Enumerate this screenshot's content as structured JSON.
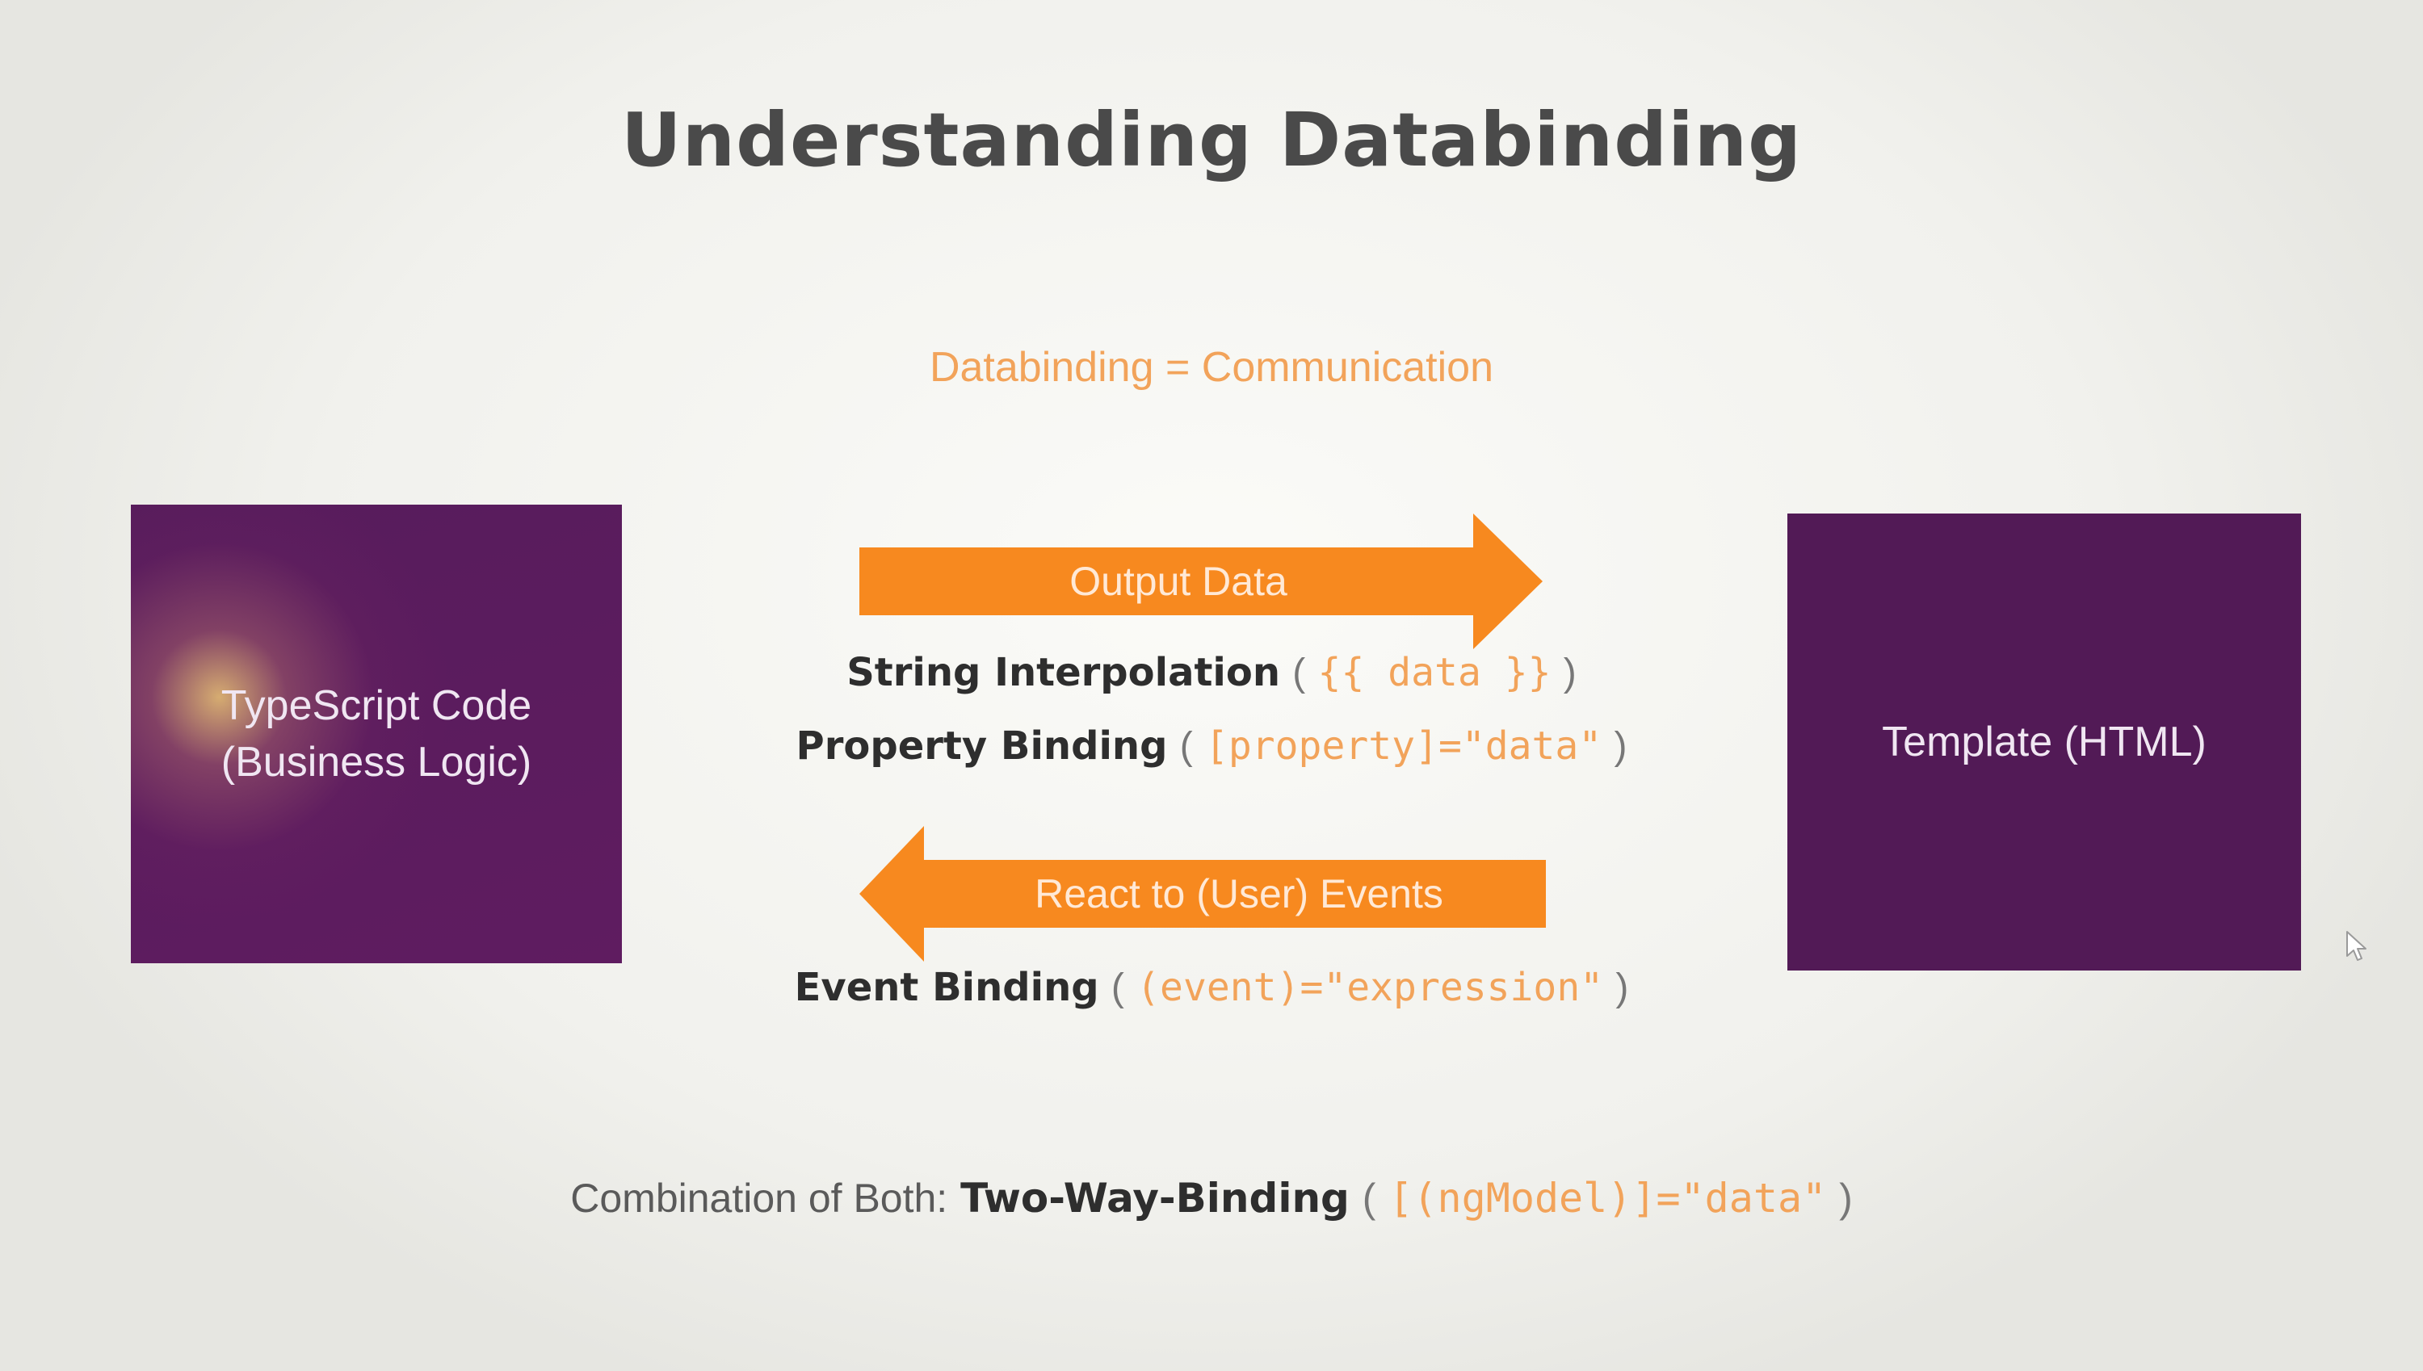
{
  "slide": {
    "title": "Understanding Databinding",
    "subtitle": "Databinding = Communication"
  },
  "left_box": {
    "line1": "TypeScript Code",
    "line2": "(Business Logic)"
  },
  "right_box": {
    "label": "Template (HTML)"
  },
  "output_arrow": {
    "label": "Output Data",
    "direction": "right",
    "color": "#f7891f"
  },
  "input_arrow": {
    "label": "React to (User) Events",
    "direction": "left",
    "color": "#f7891f"
  },
  "bindings": {
    "string_interpolation": {
      "name": "String Interpolation",
      "open": "(",
      "syntax": "{{ data }}",
      "close": ")"
    },
    "property_binding": {
      "name": "Property Binding",
      "open": "(",
      "syntax": "[property]=\"data\"",
      "close": ")"
    },
    "event_binding": {
      "name": "Event Binding",
      "open": "(",
      "syntax": "(event)=\"expression\"",
      "close": ")"
    },
    "two_way_binding": {
      "prefix": "Combination of Both:",
      "name": "Two-Way-Binding",
      "open": "(",
      "syntax": "[(ngModel)]=\"data\"",
      "close": ")"
    }
  },
  "colors": {
    "box_purple": "#521a56",
    "accent_orange": "#f2a35a",
    "title_gray": "#4a4a4a"
  },
  "icons": {
    "cursor": "mouse-pointer-icon"
  }
}
